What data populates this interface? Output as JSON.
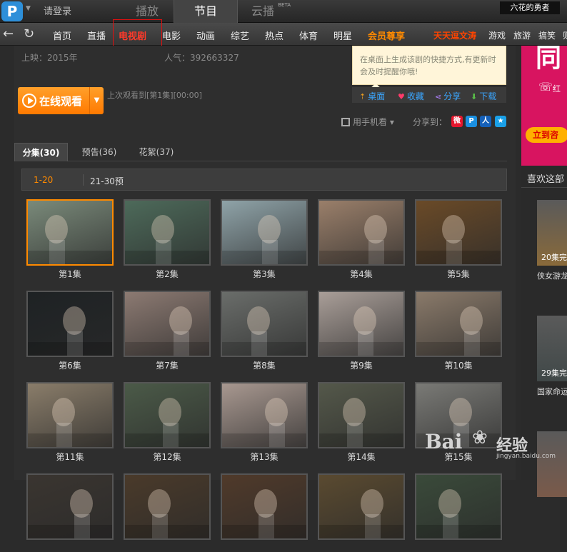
{
  "header": {
    "login_label": "请登录",
    "tabs": [
      {
        "label": "播放",
        "beta": ""
      },
      {
        "label": "节目",
        "beta": ""
      },
      {
        "label": "云播",
        "beta": "BETA"
      }
    ],
    "promo_right": "六花的勇者"
  },
  "nav": {
    "items": [
      "首页",
      "直播",
      "电视剧",
      "电影",
      "动画",
      "综艺",
      "热点",
      "体育",
      "明星"
    ],
    "vip": "会员尊享",
    "promo": "天天逗文涛",
    "extra": [
      "游戏",
      "旅游",
      "搞笑",
      "则"
    ]
  },
  "show": {
    "release_label": "上映：2015年",
    "popularity_label": "人气：392663327",
    "watch_button": "在线观看",
    "last_watched": "上次观看到[第1集][00:00]"
  },
  "tooltip": {
    "text": "在桌面上生成该剧的快捷方式,有更新时会及时提醒你哦!",
    "actions": [
      {
        "label": "桌面",
        "icon": "desktop-icon"
      },
      {
        "label": "收藏",
        "icon": "heart-icon"
      },
      {
        "label": "分享",
        "icon": "share-icon"
      },
      {
        "label": "下载",
        "icon": "download-icon"
      }
    ]
  },
  "social": {
    "mobile_label": "用手机看",
    "share_label": "分享到：",
    "targets": [
      {
        "name": "weibo-icon",
        "glyph": "微",
        "color": "#e6162d"
      },
      {
        "name": "qzone-icon",
        "glyph": "P",
        "color": "#1a8fe0"
      },
      {
        "name": "renren-icon",
        "glyph": "人",
        "color": "#1560b8"
      },
      {
        "name": "qq-star-icon",
        "glyph": "★",
        "color": "#1aa0e8"
      }
    ]
  },
  "episodes_tabs": [
    {
      "label": "分集(30)"
    },
    {
      "label": "预告(36)"
    },
    {
      "label": "花絮(37)"
    }
  ],
  "ranges": [
    "1-20",
    "21-30预"
  ],
  "episodes": [
    {
      "label": "第1集",
      "bg": "#7a8a7a"
    },
    {
      "label": "第2集",
      "bg": "#4d6a5a"
    },
    {
      "label": "第3集",
      "bg": "#8fa3a8"
    },
    {
      "label": "第4集",
      "bg": "#9a7f6a"
    },
    {
      "label": "第5集",
      "bg": "#6a4a28"
    },
    {
      "label": "第6集",
      "bg": "#1e2224"
    },
    {
      "label": "第7集",
      "bg": "#8c7a72"
    },
    {
      "label": "第8集",
      "bg": "#6a6d6a"
    },
    {
      "label": "第9集",
      "bg": "#a99e98"
    },
    {
      "label": "第10集",
      "bg": "#8a7a6a"
    },
    {
      "label": "第11集",
      "bg": "#8a7d6a"
    },
    {
      "label": "第12集",
      "bg": "#4b5a48"
    },
    {
      "label": "第13集",
      "bg": "#a89890"
    },
    {
      "label": "第14集",
      "bg": "#54584a"
    },
    {
      "label": "第15集",
      "bg": "#7a7a76"
    },
    {
      "label": "",
      "bg": "#3a3530"
    },
    {
      "label": "",
      "bg": "#4a3a2a"
    },
    {
      "label": "",
      "bg": "#503a2a"
    },
    {
      "label": "",
      "bg": "#5a4a30"
    },
    {
      "label": "",
      "bg": "#3a4a3a"
    }
  ],
  "sidebar": {
    "ad_text": "同",
    "ad_button": "立到咨",
    "ad_phone": "红",
    "like_title": "喜欢这部",
    "recs": [
      {
        "badge": "20集完",
        "title": "侠女游龙",
        "bg": "#8a6a3a"
      },
      {
        "badge": "29集完",
        "title": "国家命运",
        "bg": "#404848"
      },
      {
        "badge": "",
        "title": "",
        "bg": "#7a5a4a"
      }
    ]
  },
  "watermark": {
    "brand": "Bai",
    "brand2": "经验",
    "sub": "jingyan.baidu.com"
  }
}
